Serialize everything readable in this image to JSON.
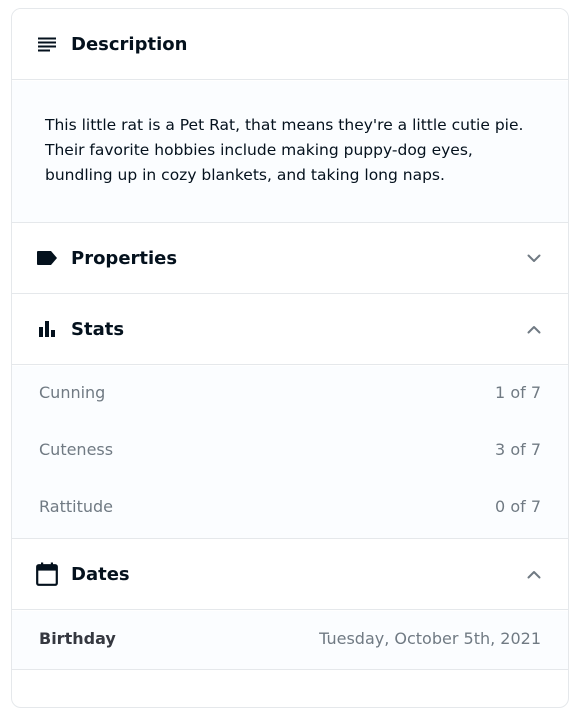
{
  "description": {
    "title": "Description",
    "icon": "notes-icon",
    "text": "This little rat is a Pet Rat, that means they're a little cutie pie. Their favorite hobbies include making puppy-dog eyes, bundling up in cozy blankets, and taking long naps."
  },
  "properties": {
    "title": "Properties",
    "icon": "label-icon",
    "expanded": false
  },
  "stats": {
    "title": "Stats",
    "icon": "bar-chart-icon",
    "expanded": true,
    "items": [
      {
        "name": "Cunning",
        "value": "1 of 7"
      },
      {
        "name": "Cuteness",
        "value": "3 of 7"
      },
      {
        "name": "Rattitude",
        "value": "0 of 7"
      }
    ]
  },
  "dates": {
    "title": "Dates",
    "icon": "calendar-icon",
    "expanded": true,
    "items": [
      {
        "label": "Birthday",
        "value": "Tuesday, October 5th, 2021"
      }
    ]
  },
  "colors": {
    "heading": "#04111d",
    "muted": "#707a83",
    "border": "#e5e8eb",
    "panel_bg": "#fbfdff"
  }
}
